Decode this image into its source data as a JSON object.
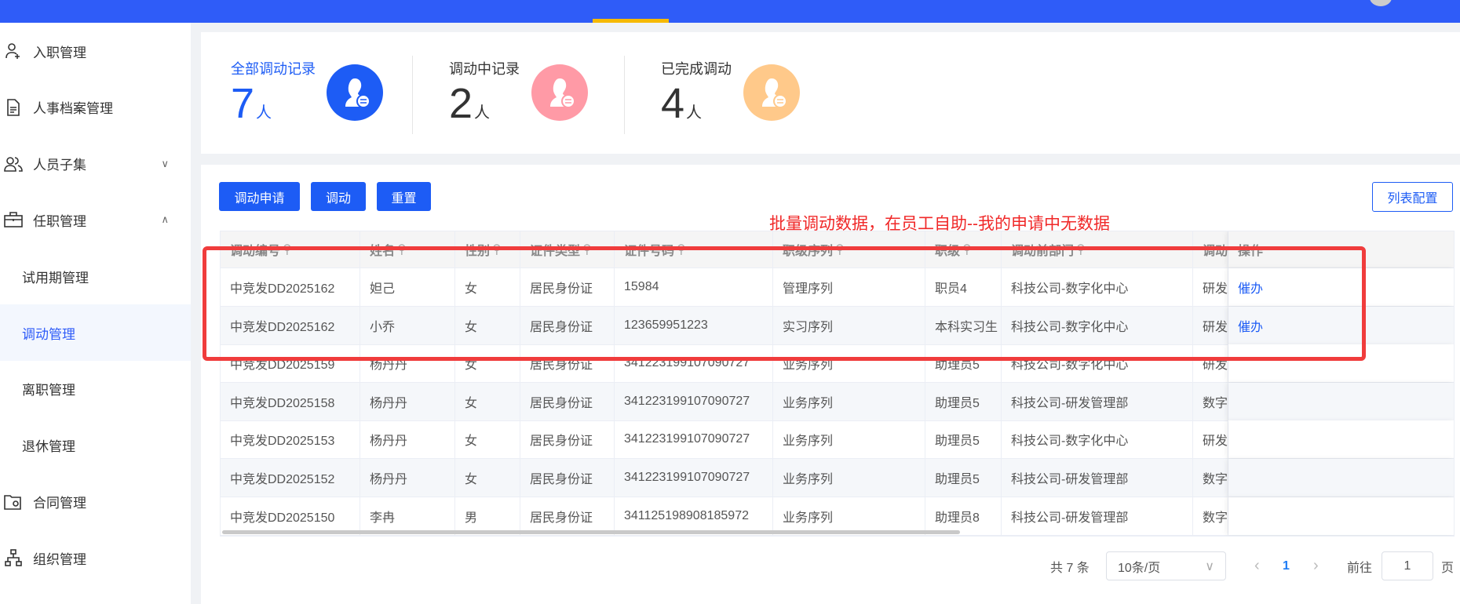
{
  "sidebar": {
    "items": [
      {
        "label": "入职管理",
        "icon": "user-add-icon"
      },
      {
        "label": "人事档案管理",
        "icon": "document-icon"
      },
      {
        "label": "人员子集",
        "icon": "users-icon",
        "chevron": "∨"
      },
      {
        "label": "任职管理",
        "icon": "briefcase-icon",
        "chevron": "∧"
      },
      {
        "label": "试用期管理"
      },
      {
        "label": "调动管理",
        "active": true
      },
      {
        "label": "离职管理"
      },
      {
        "label": "退休管理"
      },
      {
        "label": "合同管理",
        "icon": "contract-icon"
      },
      {
        "label": "组织管理",
        "icon": "org-icon"
      }
    ]
  },
  "stats": [
    {
      "label": "全部调动记录",
      "value": "7",
      "unit": "人",
      "color": "#1d5cf5"
    },
    {
      "label": "调动中记录",
      "value": "2",
      "unit": "人",
      "color": "#ff9aa6"
    },
    {
      "label": "已完成调动",
      "value": "4",
      "unit": "人",
      "color": "#ffc98a"
    }
  ],
  "toolbar": {
    "apply": "调动申请",
    "transfer": "调动",
    "reset": "重置",
    "config": "列表配置"
  },
  "annotation": "批量调动数据，在员工自助--我的申请中无数据",
  "table": {
    "headers": [
      "调动编号",
      "姓名",
      "性别",
      "证件类型",
      "证件号码",
      "职级序列",
      "职级",
      "调动前部门",
      "调动后部门",
      "操作"
    ],
    "rows": [
      [
        "中竞发DD2025162",
        "妲己",
        "女",
        "居民身份证",
        "15984",
        "管理序列",
        "职员4",
        "科技公司-数字化中心",
        "研发",
        "催办"
      ],
      [
        "中竞发DD2025162",
        "小乔",
        "女",
        "居民身份证",
        "123659951223",
        "实习序列",
        "本科实习生",
        "科技公司-数字化中心",
        "研发",
        "催办"
      ],
      [
        "中竞发DD2025159",
        "杨丹丹",
        "女",
        "居民身份证",
        "341223199107090727",
        "业务序列",
        "助理员5",
        "科技公司-数字化中心",
        "研发",
        ""
      ],
      [
        "中竞发DD2025158",
        "杨丹丹",
        "女",
        "居民身份证",
        "341223199107090727",
        "业务序列",
        "助理员5",
        "科技公司-研发管理部",
        "数字",
        ""
      ],
      [
        "中竞发DD2025153",
        "杨丹丹",
        "女",
        "居民身份证",
        "341223199107090727",
        "业务序列",
        "助理员5",
        "科技公司-数字化中心",
        "研发",
        ""
      ],
      [
        "中竞发DD2025152",
        "杨丹丹",
        "女",
        "居民身份证",
        "341223199107090727",
        "业务序列",
        "助理员5",
        "科技公司-研发管理部",
        "数字",
        ""
      ],
      [
        "中竞发DD2025150",
        "李冉",
        "男",
        "居民身份证",
        "341125198908185972",
        "业务序列",
        "助理员8",
        "科技公司-研发管理部",
        "数字",
        ""
      ]
    ]
  },
  "pagination": {
    "total": "共 7 条",
    "page_size": "10条/页",
    "prev": "‹",
    "current": "1",
    "next": "›",
    "goto": "前往",
    "goto_value": "1",
    "page_unit": "页"
  }
}
